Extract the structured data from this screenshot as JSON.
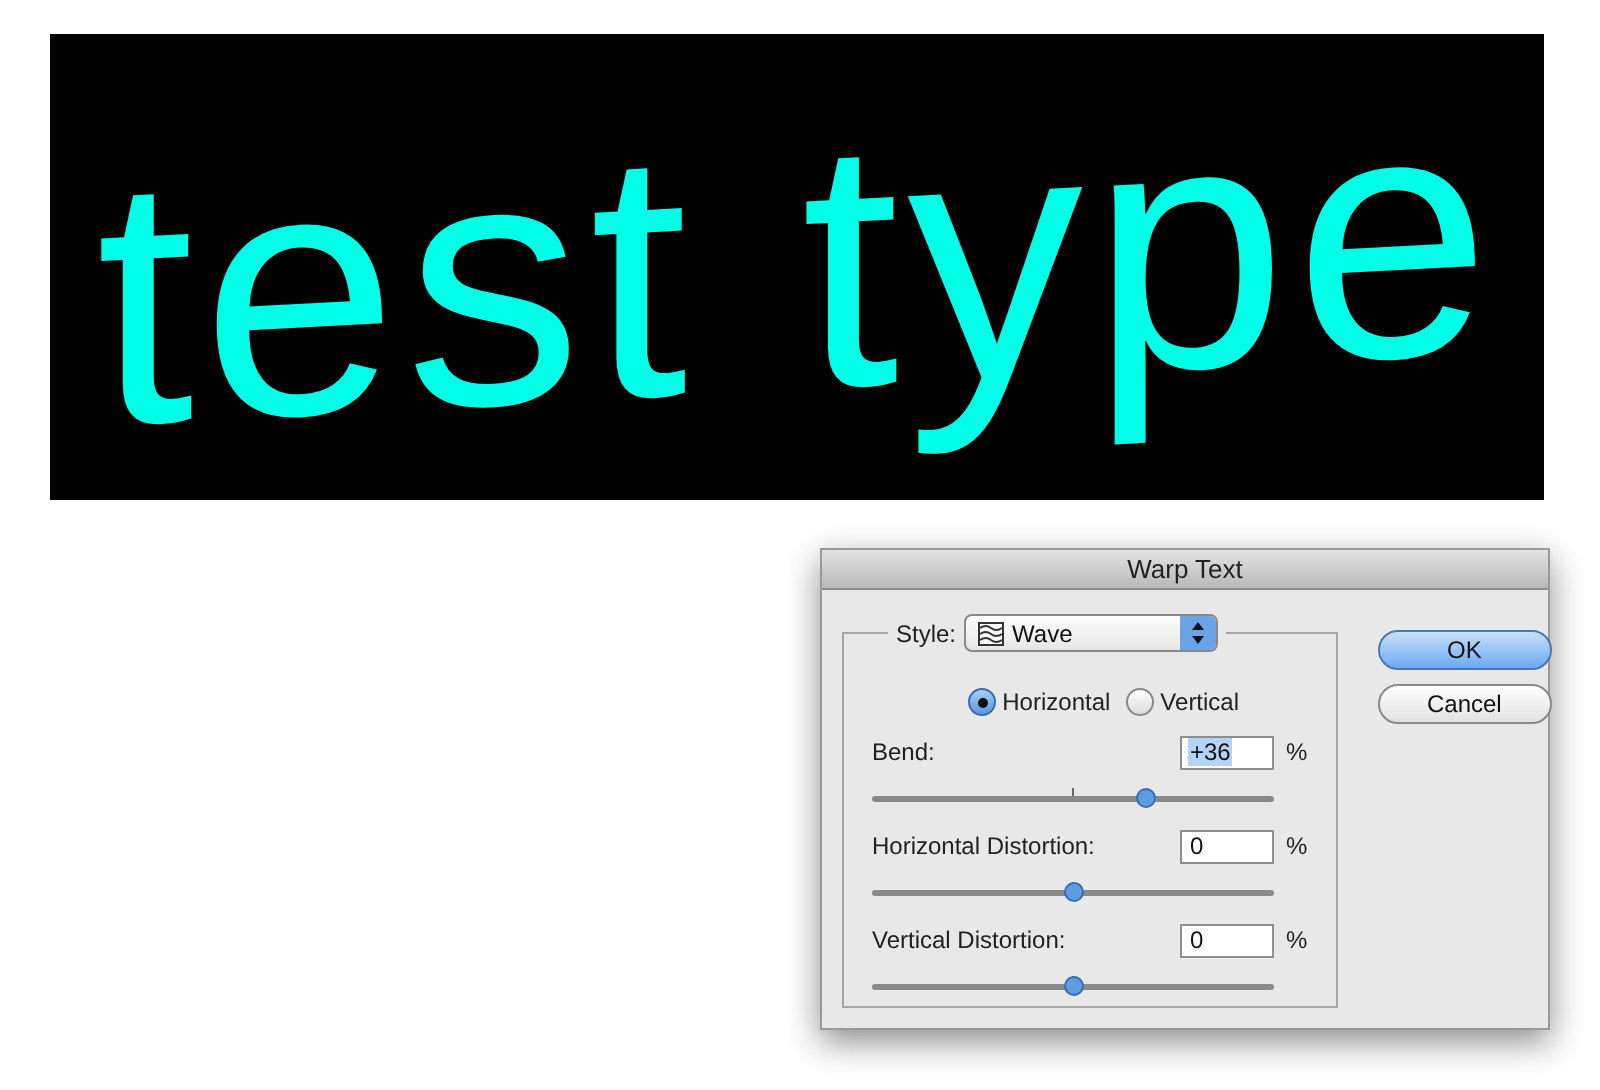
{
  "canvas": {
    "text": "test type"
  },
  "dialog": {
    "title": "Warp Text",
    "style": {
      "label": "Style:",
      "value": "Wave"
    },
    "orientation": [
      {
        "label": "Horizontal",
        "selected": true
      },
      {
        "label": "Vertical",
        "selected": false
      }
    ],
    "parameters": [
      {
        "label": "Bend:",
        "value": "+36",
        "unit": "%",
        "level": 0.68,
        "highlighted": true
      },
      {
        "label": "Horizontal Distortion:",
        "value": "0",
        "unit": "%",
        "level": 0.5,
        "highlighted": false
      },
      {
        "label": "Vertical Distortion:",
        "value": "0",
        "unit": "%",
        "level": 0.5,
        "highlighted": false
      }
    ],
    "buttons": [
      {
        "label": "OK",
        "default": true
      },
      {
        "label": "Cancel",
        "default": false
      }
    ]
  }
}
